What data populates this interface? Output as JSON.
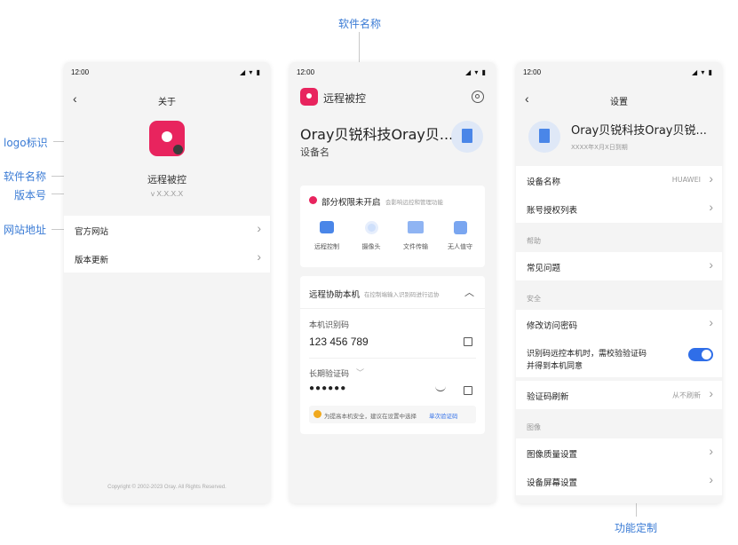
{
  "annotations": {
    "logo": "logo标识",
    "app_name": "软件名称",
    "version": "版本号",
    "website": "网站地址",
    "top_app_name": "软件名称",
    "bottom_feature": "功能定制"
  },
  "status_bar": {
    "time": "12:00",
    "icons": "◢ ▾ ▮"
  },
  "screen1": {
    "nav_title": "关于",
    "app_name": "远程被控",
    "version": "v X.X.X.X",
    "rows": [
      "官方网站",
      "版本更新"
    ],
    "copyright": "Copyright © 2002-2023 Oray. All Rights Reserved."
  },
  "screen2": {
    "app_name": "远程被控",
    "company": "Oray贝锐科技Oray贝...",
    "device_label": "设备名",
    "permission": {
      "title": "部分权限未开启",
      "sub": "会影响远控和管理功能"
    },
    "features": [
      "远程控制",
      "摄像头",
      "文件传输",
      "无人值守"
    ],
    "assist": {
      "title": "远程协助本机",
      "sub": "在控制端输入识别码进行远协",
      "code_label": "本机识别码",
      "code_value": "123 456 789",
      "pwd_label": "长期验证码",
      "pwd_value": "●●●●●●",
      "tip": "为提高本机安全，建议在设置中选择",
      "tip_link": "单次验证码"
    }
  },
  "screen3": {
    "nav_title": "设置",
    "company": "Oray贝锐科技Oray贝锐...",
    "expire": "XXXX年X月X日到期",
    "rows": {
      "device_name": "设备名称",
      "device_name_val": "HUAWEI",
      "auth_list": "账号授权列表",
      "help_section": "帮助",
      "faq": "常见问题",
      "security_section": "安全",
      "change_pwd": "修改访问密码",
      "verify_line1": "识别码远控本机时，需校验验证码",
      "verify_line2": "并得到本机同意",
      "refresh": "验证码刷新",
      "refresh_val": "从不刷新",
      "image_section": "图像",
      "quality": "图像质量设置",
      "screen": "设备屏幕设置"
    }
  },
  "colors": {
    "accent": "#2f6ee8",
    "logo": "#e8245e",
    "annotation": "#3a7bd5"
  }
}
